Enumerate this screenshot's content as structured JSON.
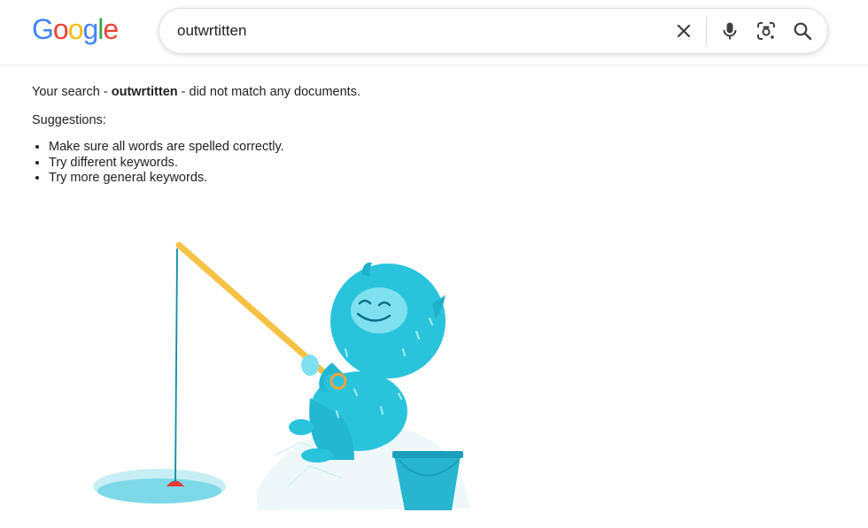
{
  "logo": {
    "letters": [
      "G",
      "o",
      "o",
      "g",
      "l",
      "e"
    ],
    "colors": [
      "#4285F4",
      "#EA4335",
      "#FBBC05",
      "#4285F4",
      "#34A853",
      "#EA4335"
    ]
  },
  "search": {
    "query": "outwrtitten",
    "placeholder": ""
  },
  "icons": {
    "clear": "close-icon",
    "voice": "microphone-icon",
    "lens": "camera-lens-icon",
    "search": "search-icon"
  },
  "results": {
    "message_prefix": "Your search - ",
    "message_query": "outwrtitten",
    "message_suffix": " - did not match any documents.",
    "suggestions_title": "Suggestions:",
    "suggestions": [
      "Make sure all words are spelled correctly.",
      "Try different keywords.",
      "Try more general keywords."
    ]
  },
  "illustration": {
    "subject": "blue-furry-monster-ice-fishing",
    "accent": "#26C6DA"
  }
}
